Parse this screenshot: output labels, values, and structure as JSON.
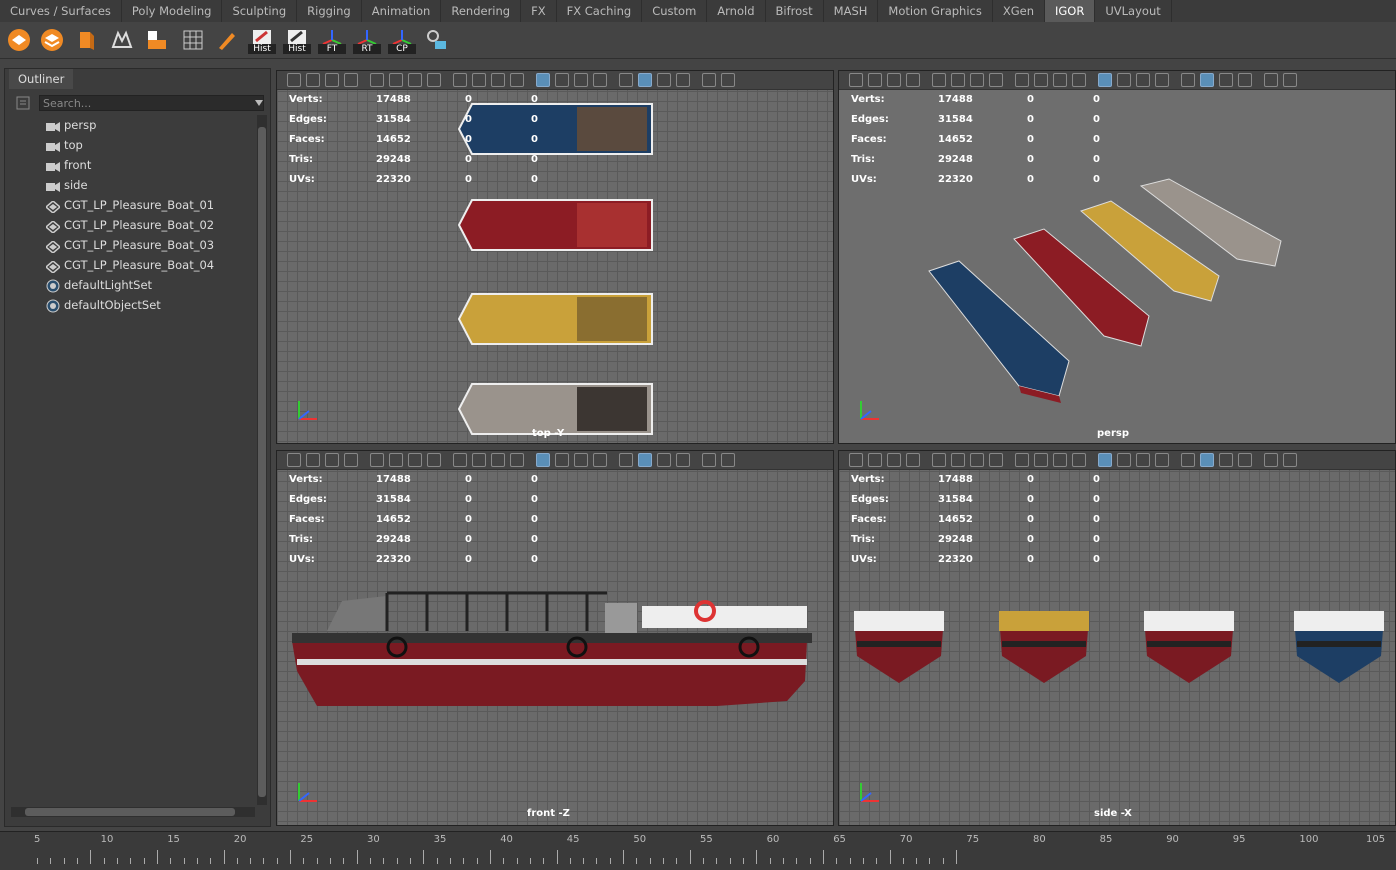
{
  "shelf_tabs": [
    "Curves / Surfaces",
    "Poly Modeling",
    "Sculpting",
    "Rigging",
    "Animation",
    "Rendering",
    "FX",
    "FX Caching",
    "Custom",
    "Arnold",
    "Bifrost",
    "MASH",
    "Motion Graphics",
    "XGen",
    "IGOR",
    "UVLayout"
  ],
  "active_shelf_tab": "IGOR",
  "shelf_button_labels": {
    "hist1": "Hist",
    "hist2": "Hist",
    "ft": "FT",
    "rt": "RT",
    "cp": "CP"
  },
  "outliner": {
    "tab": "Outliner",
    "search_placeholder": "Search...",
    "items": [
      "persp",
      "top",
      "front",
      "side",
      "CGT_LP_Pleasure_Boat_01",
      "CGT_LP_Pleasure_Boat_02",
      "CGT_LP_Pleasure_Boat_03",
      "CGT_LP_Pleasure_Boat_04",
      "defaultLightSet",
      "defaultObjectSet"
    ],
    "item_icons": [
      "camera-icon",
      "camera-icon",
      "camera-icon",
      "camera-icon",
      "mesh-group-icon",
      "mesh-group-icon",
      "mesh-group-icon",
      "mesh-group-icon",
      "set-icon",
      "set-icon"
    ]
  },
  "hud": {
    "labels": [
      "Verts:",
      "Edges:",
      "Faces:",
      "Tris:",
      "UVs:"
    ],
    "values": [
      "17488",
      "31584",
      "14652",
      "29248",
      "22320"
    ],
    "zeros": [
      "0",
      "0"
    ]
  },
  "viewports": {
    "top": "top -Y",
    "persp": "persp",
    "front": "front -Z",
    "side": "side -X"
  },
  "boat_colors": {
    "blue": "#1d3e64",
    "red": "#8c1c24",
    "yellow": "#c9a13a",
    "grey": "#9a938c"
  },
  "timeline": {
    "ticks": [
      "5",
      "10",
      "15",
      "20",
      "25",
      "30",
      "35",
      "40",
      "45",
      "50",
      "55",
      "60",
      "65",
      "70",
      "75",
      "80",
      "85",
      "90",
      "95",
      "100",
      "105"
    ]
  }
}
